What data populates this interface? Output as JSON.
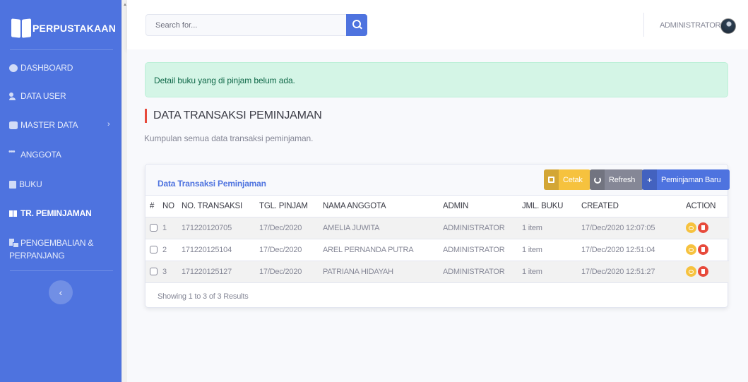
{
  "brand": {
    "title": "PERPUSTAKAAN"
  },
  "sidebar": {
    "items": [
      {
        "label": "DASHBOARD",
        "icon": "dashboard-icon"
      },
      {
        "label": "DATA USER",
        "icon": "user-cog-icon"
      },
      {
        "label": "MASTER DATA",
        "icon": "database-icon",
        "has_caret": true
      },
      {
        "label": "ANGGOTA",
        "icon": "users-icon"
      },
      {
        "label": "BUKU",
        "icon": "book-icon"
      },
      {
        "label": "TR. PEMINJAMAN",
        "icon": "book-open-icon",
        "active": true
      },
      {
        "label_line1": "PENGEMBALIAN &",
        "label_line2": "PERPANJANG",
        "icon": "book-return-icon"
      }
    ],
    "toggle_glyph": "‹"
  },
  "topbar": {
    "search_placeholder": "Search for...",
    "user_name": "ADMINISTRATOR"
  },
  "alert": {
    "message": "Detail buku yang di pinjam belum ada."
  },
  "page": {
    "title": "DATA TRANSAKSI PEMINJAMAN",
    "subtitle": "Kumpulan semua data transaksi peminjaman."
  },
  "card": {
    "title": "Data Transaksi Peminjaman",
    "buttons": {
      "print": "Cetak",
      "refresh": "Refresh",
      "new": "Peminjaman Baru"
    },
    "columns": [
      "#",
      "NO",
      "NO. TRANSAKSI",
      "TGL. PINJAM",
      "NAMA ANGGOTA",
      "ADMIN",
      "JML. BUKU",
      "CREATED",
      "ACTION"
    ],
    "rows": [
      {
        "no": "1",
        "trx": "171220120705",
        "tgl": "17/Dec/2020",
        "nama": "AMELIA JUWITA",
        "admin": "ADMINISTRATOR",
        "jml": "1 item",
        "created": "17/Dec/2020 12:07:05"
      },
      {
        "no": "2",
        "trx": "171220125104",
        "tgl": "17/Dec/2020",
        "nama": "AREL PERNANDA PUTRA",
        "admin": "ADMINISTRATOR",
        "jml": "1 item",
        "created": "17/Dec/2020 12:51:04"
      },
      {
        "no": "3",
        "trx": "171220125127",
        "tgl": "17/Dec/2020",
        "nama": "PATRIANA HIDAYAH",
        "admin": "ADMINISTRATOR",
        "jml": "1 item",
        "created": "17/Dec/2020 12:51:27"
      }
    ],
    "footer": "Showing 1 to 3 of 3 Results"
  },
  "colors": {
    "primary": "#4e73df",
    "warning": "#f6c23e",
    "danger": "#e74a3b",
    "secondary": "#858796",
    "success_bg": "#d4f5e6"
  }
}
